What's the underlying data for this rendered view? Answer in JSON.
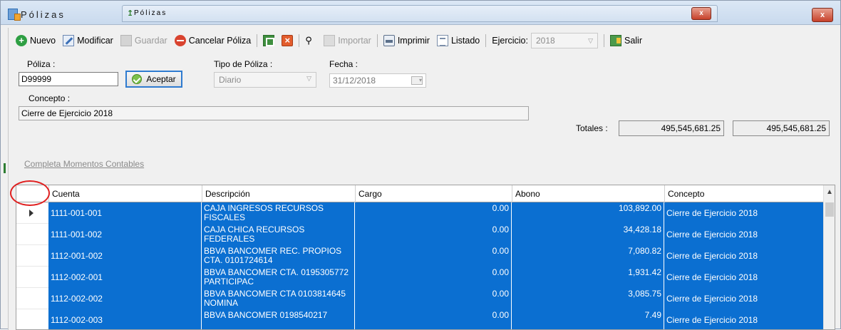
{
  "outer_window": {
    "title": "Pólizas",
    "close_label": "x"
  },
  "inner_window": {
    "title": "Pólizas",
    "close_label": "x"
  },
  "toolbar": {
    "nuevo": "Nuevo",
    "modificar": "Modificar",
    "guardar": "Guardar",
    "cancelar": "Cancelar Póliza",
    "importar": "Importar",
    "imprimir": "Imprimir",
    "listado": "Listado",
    "ejercicio_label": "Ejercicio:",
    "ejercicio_value": "2018",
    "salir": "Salir"
  },
  "form": {
    "poliza_label": "Póliza :",
    "poliza_value": "D99999",
    "aceptar": "Aceptar",
    "tipo_label": "Tipo de Póliza :",
    "tipo_value": "Diario",
    "fecha_label": "Fecha :",
    "fecha_value": "31/12/2018",
    "concepto_label": "Concepto :",
    "concepto_value": "Cierre de Ejercicio 2018",
    "totales_label": "Totales :",
    "total_cargo": "495,545,681.25",
    "total_abono": "495,545,681.25",
    "link": "Completa Momentos Contables"
  },
  "grid": {
    "columns": [
      "Cuenta",
      "Descripción",
      "Cargo",
      "Abono",
      "Concepto"
    ],
    "rows": [
      {
        "cuenta": "1111-001-001",
        "descripcion": "CAJA INGRESOS RECURSOS FISCALES",
        "cargo": "0.00",
        "abono": "103,892.00",
        "concepto": "Cierre de Ejercicio 2018"
      },
      {
        "cuenta": "1111-001-002",
        "descripcion": "CAJA CHICA RECURSOS FEDERALES",
        "cargo": "0.00",
        "abono": "34,428.18",
        "concepto": "Cierre de Ejercicio 2018"
      },
      {
        "cuenta": "1112-001-002",
        "descripcion": "BBVA BANCOMER REC. PROPIOS CTA. 0101724614",
        "cargo": "0.00",
        "abono": "7,080.82",
        "concepto": "Cierre de Ejercicio 2018"
      },
      {
        "cuenta": "1112-002-001",
        "descripcion": "BBVA BANCOMER CTA. 0195305772 PARTICIPAC",
        "cargo": "0.00",
        "abono": "1,931.42",
        "concepto": "Cierre de Ejercicio 2018"
      },
      {
        "cuenta": "1112-002-002",
        "descripcion": "BBVA BANCOMER CTA 0103814645 NOMINA",
        "cargo": "0.00",
        "abono": "3,085.75",
        "concepto": "Cierre de Ejercicio 2018"
      },
      {
        "cuenta": "1112-002-003",
        "descripcion": "BBVA BANCOMER 0198540217",
        "cargo": "0.00",
        "abono": "7.49",
        "concepto": "Cierre de Ejercicio 2018"
      }
    ]
  },
  "colors": {
    "selection": "#0b6fd1",
    "highlight_circle": "#e02020"
  }
}
